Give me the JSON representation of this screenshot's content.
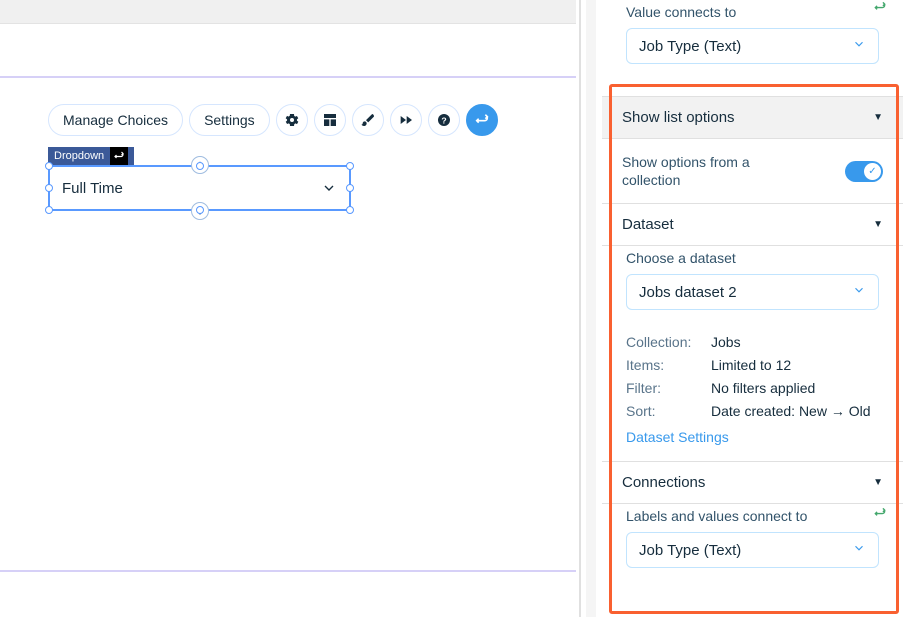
{
  "toolbar": {
    "manage_label": "Manage Choices",
    "settings_label": "Settings",
    "icons": [
      "gear",
      "layout",
      "paint",
      "motion",
      "help",
      "data-link"
    ]
  },
  "dropdown_element": {
    "tag": "Dropdown",
    "value": "Full Time"
  },
  "panel": {
    "value_connects": {
      "label": "Value connects to",
      "value": "Job Type (Text)"
    },
    "list_options_header": "Show list options",
    "show_from_collection_label": "Show options from a collection",
    "show_from_collection_on": true,
    "dataset_header": "Dataset",
    "choose_dataset_label": "Choose a dataset",
    "dataset_value": "Jobs dataset 2",
    "collection_k": "Collection:",
    "collection_v": "Jobs",
    "items_k": "Items:",
    "items_v": "Limited to 12",
    "filter_k": "Filter:",
    "filter_v": "No filters applied",
    "sort_k": "Sort:",
    "sort_v": "Date created: New → Old",
    "dataset_settings_link": "Dataset Settings",
    "connections_header": "Connections",
    "labels_values_label": "Labels and values connect to",
    "labels_values_value": "Job Type (Text)"
  }
}
